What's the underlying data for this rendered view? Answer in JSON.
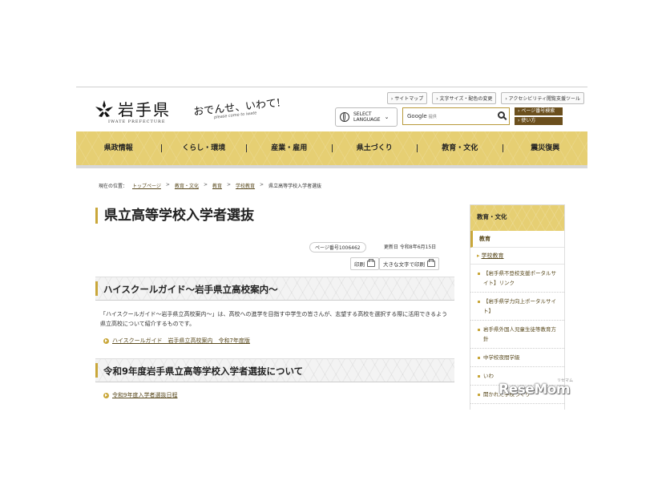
{
  "header": {
    "logo_text": "岩手県",
    "logo_sub": "IWATE PREFECTURE",
    "slogan": "おでんせ、いわて!",
    "slogan_sub": "please come to iwate",
    "top_links": [
      "サイトマップ",
      "文字サイズ・配色の変更",
      "アクセシビリティ閲覧支援ツール"
    ],
    "lang_line1": "SELECT",
    "lang_line2": "LANGUAGE",
    "search_brand": "Google",
    "search_brand_sub": "提供",
    "page_search": "ページ番号検索",
    "how_to_use": "使い方"
  },
  "nav": [
    "県政情報",
    "くらし・環境",
    "産業・雇用",
    "県土づくり",
    "教育・文化",
    "震災復興"
  ],
  "breadcrumb": {
    "label": "現在の位置：",
    "links": [
      "トップページ",
      "教育・文化",
      "教育",
      "学校教育"
    ],
    "current": "県立高等学校入学者選抜"
  },
  "page": {
    "title": "県立高等学校入学者選抜",
    "page_number": "ページ番号1006462",
    "updated": "更新日  令和8年6月15日",
    "print_label": "印刷",
    "print_large_label": "大きな文字で印刷"
  },
  "sections": [
    {
      "heading": "ハイスクールガイド～岩手県立高校案内～",
      "body": "「ハイスクールガイド～岩手県立高校案内～」は、高校への進学を目指す中学生の皆さんが、志望する高校を選択する際に活用できるよう県立高校について紹介するものです。",
      "link": "ハイスクールガイド　岩手県立高校案内　令和7年度版"
    },
    {
      "heading": "令和9年度岩手県立高等学校入学者選抜について",
      "link": "令和9年度入学者選抜日程"
    }
  ],
  "sidebar": {
    "heading": "教育・文化",
    "sub": "教育",
    "category": "学校教育",
    "items": [
      "【岩手県不登校支援ポータルサイト】リンク",
      "【岩手県学力向上ポータルサイト】",
      "岩手県外国人児童生徒等教育方針",
      "中学校夜間学級",
      "いわ",
      "開かれた学校づくり"
    ]
  },
  "watermark": {
    "text": "ReseMom",
    "small": "リセマム"
  }
}
